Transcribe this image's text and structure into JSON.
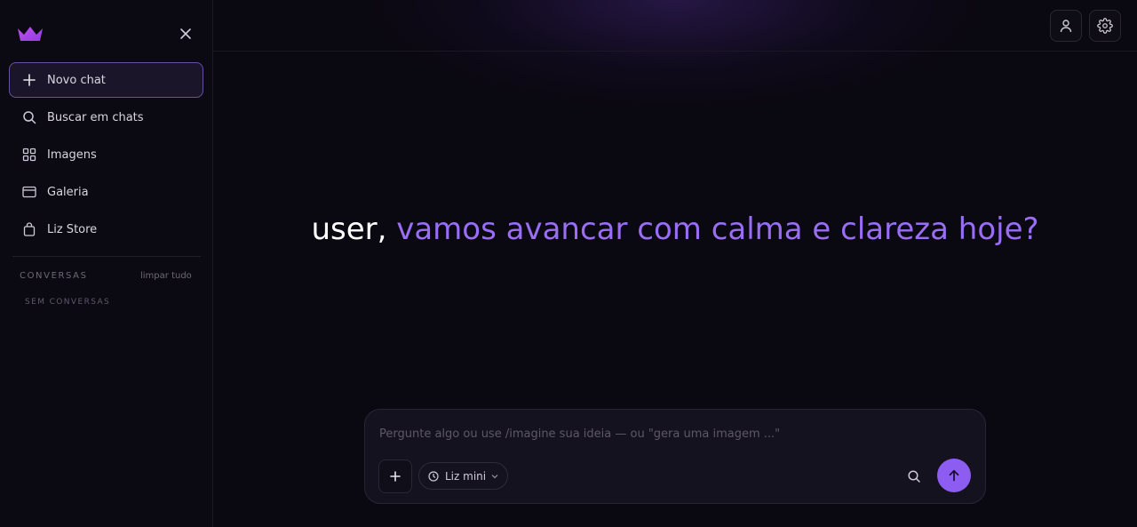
{
  "sidebar": {
    "items": [
      {
        "label": "Novo chat",
        "icon": "plus-icon"
      },
      {
        "label": "Buscar em chats",
        "icon": "search-icon"
      },
      {
        "label": "Imagens",
        "icon": "grid-icon"
      },
      {
        "label": "Galeria",
        "icon": "card-icon"
      },
      {
        "label": "Liz Store",
        "icon": "shopping-bag-icon"
      }
    ],
    "conversations_label": "CONVERSAS",
    "clear_all_label": "limpar tudo",
    "empty_label": "SEM CONVERSAS"
  },
  "greeting": {
    "name": "user,",
    "message": "vamos avancar com calma e clareza hoje?"
  },
  "composer": {
    "placeholder": "Pergunte algo ou use /imagine sua ideia — ou \"gera uma imagem ...\"",
    "model_label": "Liz mini"
  },
  "colors": {
    "accent": "#8d5cf0",
    "greeting_accent": "#9a6df5",
    "logo": "#b04ae8",
    "background": "#0a0810"
  }
}
